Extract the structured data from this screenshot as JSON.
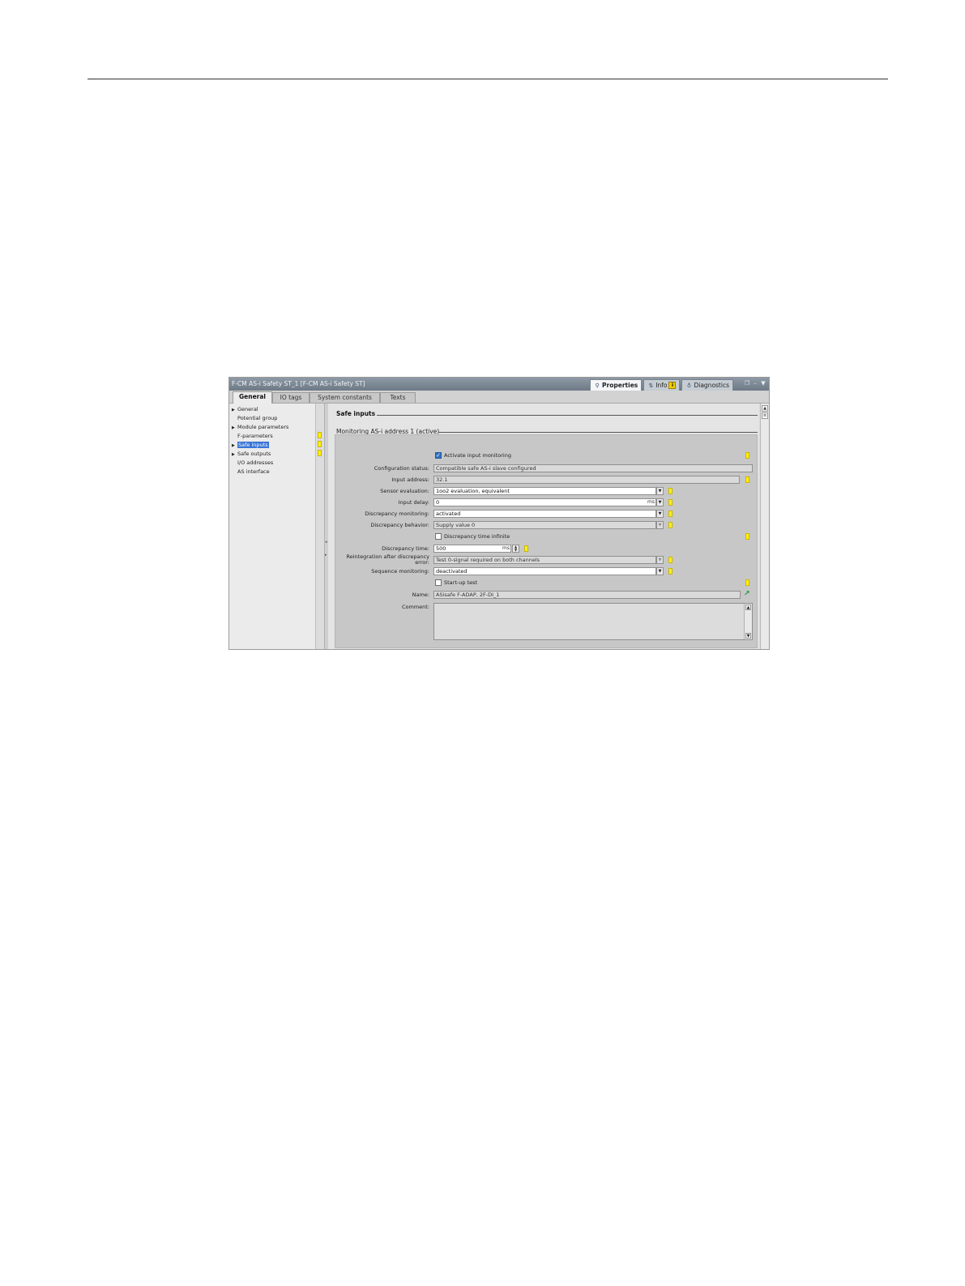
{
  "window": {
    "title": "F-CM AS-i Safety ST_1 [F-CM AS-i Safety ST]",
    "panel_tabs": [
      {
        "label": "Properties",
        "icon": "properties-icon",
        "active": true
      },
      {
        "label": "Info",
        "icon": "info-icon",
        "badge": "i",
        "active": false
      },
      {
        "label": "Diagnostics",
        "icon": "diagnostics-icon",
        "active": false
      }
    ],
    "controls": [
      "restore-icon",
      "minimize-icon",
      "collapse-arrow-icon"
    ]
  },
  "tabs": [
    "General",
    "IO tags",
    "System constants",
    "Texts"
  ],
  "active_tab": "General",
  "nav": [
    {
      "label": "General",
      "expandable": true,
      "selected": false,
      "flag": false
    },
    {
      "label": "Potential group",
      "expandable": false,
      "selected": false,
      "flag": false
    },
    {
      "label": "Module parameters",
      "expandable": true,
      "selected": false,
      "flag": false
    },
    {
      "label": "F-parameters",
      "expandable": false,
      "selected": false,
      "flag": true
    },
    {
      "label": "Safe inputs",
      "expandable": true,
      "selected": true,
      "flag": true
    },
    {
      "label": "Safe outputs",
      "expandable": true,
      "selected": false,
      "flag": true
    },
    {
      "label": "I/O addresses",
      "expandable": false,
      "selected": false,
      "flag": false
    },
    {
      "label": "AS interface",
      "expandable": false,
      "selected": false,
      "flag": false
    }
  ],
  "content": {
    "section_title": "Safe inputs",
    "subsection_title": "Monitoring AS-i address 1 (active)",
    "activate_monitoring": {
      "label": "Activate input monitoring",
      "checked": true
    },
    "configuration_status": {
      "label": "Configuration status:",
      "value": "Compatible safe AS-i slave configured"
    },
    "input_address": {
      "label": "Input address:",
      "value": "32.1"
    },
    "sensor_evaluation": {
      "label": "Sensor evaluation:",
      "value": "1oo2 evaluation, equivalent"
    },
    "input_delay": {
      "label": "Input delay:",
      "value": "0",
      "unit": "ms"
    },
    "discrepancy_monitoring": {
      "label": "Discrepancy monitoring:",
      "value": "activated"
    },
    "discrepancy_behavior": {
      "label": "Discrepancy behavior:",
      "value": "Supply value 0"
    },
    "discrepancy_time_infinite": {
      "label": "Discrepancy time infinite",
      "checked": false
    },
    "discrepancy_time": {
      "label": "Discrepancy time:",
      "value": "500",
      "unit": "ms"
    },
    "reintegration": {
      "label_line1": "Reintegration after discrepancy",
      "label_line2": "error:",
      "value": "Test 0-signal required on both channels"
    },
    "sequence_monitoring": {
      "label": "Sequence monitoring:",
      "value": "deactivated"
    },
    "startup_test": {
      "label": "Start-up test",
      "checked": false
    },
    "name": {
      "label": "Name:",
      "value": "ASisafe F-ADAP, 2F-DI_1"
    },
    "comment": {
      "label": "Comment:",
      "value": ""
    }
  },
  "colors": {
    "titlebar": "#7d8995",
    "selection": "#3875d7",
    "flag": "#ffef1a",
    "checkbox_checked": "#2f6fbf",
    "go_link": "#1e9a2e"
  }
}
